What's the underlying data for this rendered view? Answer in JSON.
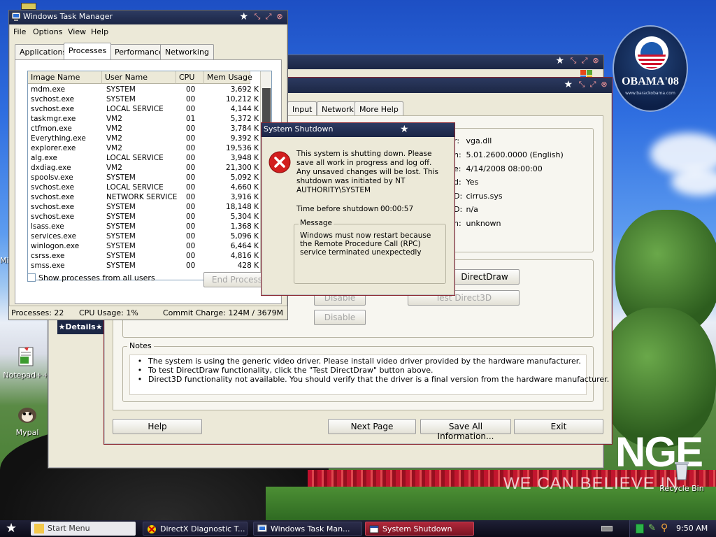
{
  "desktop": {
    "icons": [
      {
        "label": "Notepad++"
      },
      {
        "label": "Mypal"
      },
      {
        "label": "Recycle Bin"
      },
      {
        "label": "Mi"
      }
    ],
    "wallpaper": {
      "logo_text": "OBAMA'08",
      "logo_sub": "www.barackobama.com",
      "slogan_big": "NGE",
      "slogan_small": "WE CAN BELIEVE IN"
    },
    "details_label": "Details"
  },
  "dxdiag_back": {
    "title": ""
  },
  "dxdiag": {
    "tabs": [
      "Input",
      "Network",
      "More Help"
    ],
    "info_values": [
      {
        "label": "r:",
        "value": "vga.dll"
      },
      {
        "label": "n:",
        "value": "5.01.2600.0000 (English)"
      },
      {
        "label": "e:",
        "value": "4/14/2008 08:00:00"
      },
      {
        "label": "d:",
        "value": "Yes"
      },
      {
        "label": "D:",
        "value": "cirrus.sys"
      },
      {
        "label": "D:",
        "value": "n/a"
      },
      {
        "label": "n:",
        "value": "unknown"
      }
    ],
    "directdraw_button": "DirectDraw",
    "test_direct3d_button": "Test Direct3D",
    "disable_button_1": "Disable",
    "disable_button_2": "Disable",
    "notes_title": "Notes",
    "notes": [
      "The system is using the generic video driver.  Please install video driver provided by the hardware manufacturer.",
      "To test DirectDraw functionality, click the \"Test DirectDraw\" button above.",
      "Direct3D functionality not available.  You should verify that the driver is a final version from the hardware manufacturer."
    ],
    "buttons": {
      "help": "Help",
      "next_page": "Next Page",
      "save_all": "Save All Information...",
      "exit": "Exit"
    }
  },
  "taskmgr": {
    "title": "Windows Task Manager",
    "menu": [
      "File",
      "Options",
      "View",
      "Help"
    ],
    "tabs": [
      "Applications",
      "Processes",
      "Performance",
      "Networking"
    ],
    "active_tab": "Processes",
    "columns": [
      "Image Name",
      "User Name",
      "CPU",
      "Mem Usage"
    ],
    "processes": [
      {
        "name": "mdm.exe",
        "user": "SYSTEM",
        "cpu": "00",
        "mem": "3,692 K"
      },
      {
        "name": "svchost.exe",
        "user": "SYSTEM",
        "cpu": "00",
        "mem": "10,212 K"
      },
      {
        "name": "svchost.exe",
        "user": "LOCAL SERVICE",
        "cpu": "00",
        "mem": "4,144 K"
      },
      {
        "name": "taskmgr.exe",
        "user": "VM2",
        "cpu": "01",
        "mem": "5,372 K"
      },
      {
        "name": "ctfmon.exe",
        "user": "VM2",
        "cpu": "00",
        "mem": "3,784 K"
      },
      {
        "name": "Everything.exe",
        "user": "VM2",
        "cpu": "00",
        "mem": "9,392 K"
      },
      {
        "name": "explorer.exe",
        "user": "VM2",
        "cpu": "00",
        "mem": "19,536 K"
      },
      {
        "name": "alg.exe",
        "user": "LOCAL SERVICE",
        "cpu": "00",
        "mem": "3,948 K"
      },
      {
        "name": "dxdiag.exe",
        "user": "VM2",
        "cpu": "00",
        "mem": "21,300 K"
      },
      {
        "name": "spoolsv.exe",
        "user": "SYSTEM",
        "cpu": "00",
        "mem": "5,092 K"
      },
      {
        "name": "svchost.exe",
        "user": "LOCAL SERVICE",
        "cpu": "00",
        "mem": "4,660 K"
      },
      {
        "name": "svchost.exe",
        "user": "NETWORK SERVICE",
        "cpu": "00",
        "mem": "3,916 K"
      },
      {
        "name": "svchost.exe",
        "user": "SYSTEM",
        "cpu": "00",
        "mem": "18,148 K"
      },
      {
        "name": "svchost.exe",
        "user": "SYSTEM",
        "cpu": "00",
        "mem": "5,304 K"
      },
      {
        "name": "lsass.exe",
        "user": "SYSTEM",
        "cpu": "00",
        "mem": "1,368 K"
      },
      {
        "name": "services.exe",
        "user": "SYSTEM",
        "cpu": "00",
        "mem": "5,096 K"
      },
      {
        "name": "winlogon.exe",
        "user": "SYSTEM",
        "cpu": "00",
        "mem": "6,464 K"
      },
      {
        "name": "csrss.exe",
        "user": "SYSTEM",
        "cpu": "00",
        "mem": "4,816 K"
      },
      {
        "name": "smss.exe",
        "user": "SYSTEM",
        "cpu": "00",
        "mem": "428 K"
      }
    ],
    "show_all_users": "Show processes from all users",
    "end_process": "End Process",
    "status": {
      "processes": "Processes: 22",
      "cpu": "CPU Usage: 1%",
      "commit": "Commit Charge: 124M / 3679M"
    }
  },
  "shutdown": {
    "title": "System Shutdown",
    "message": "This system is shutting down. Please save all work in progress and log off. Any unsaved changes will be lost. This shutdown was initiated by NT AUTHORITY\\SYSTEM",
    "time_label": "Time before shutdown :",
    "time_value": "00:00:57",
    "group_label": "Message",
    "group_text": "Windows must now restart because the Remote Procedure Call (RPC) service terminated unexpectedly"
  },
  "taskbar": {
    "start": "Start Menu",
    "tasks": [
      {
        "label": "DirectX Diagnostic T..."
      },
      {
        "label": "Windows Task Man..."
      },
      {
        "label": "System Shutdown"
      }
    ],
    "clock": "9:50 AM"
  },
  "colors": {
    "title_bar": "#1c2745",
    "accent_red": "#8a2630",
    "error_red": "#d21e1e"
  }
}
